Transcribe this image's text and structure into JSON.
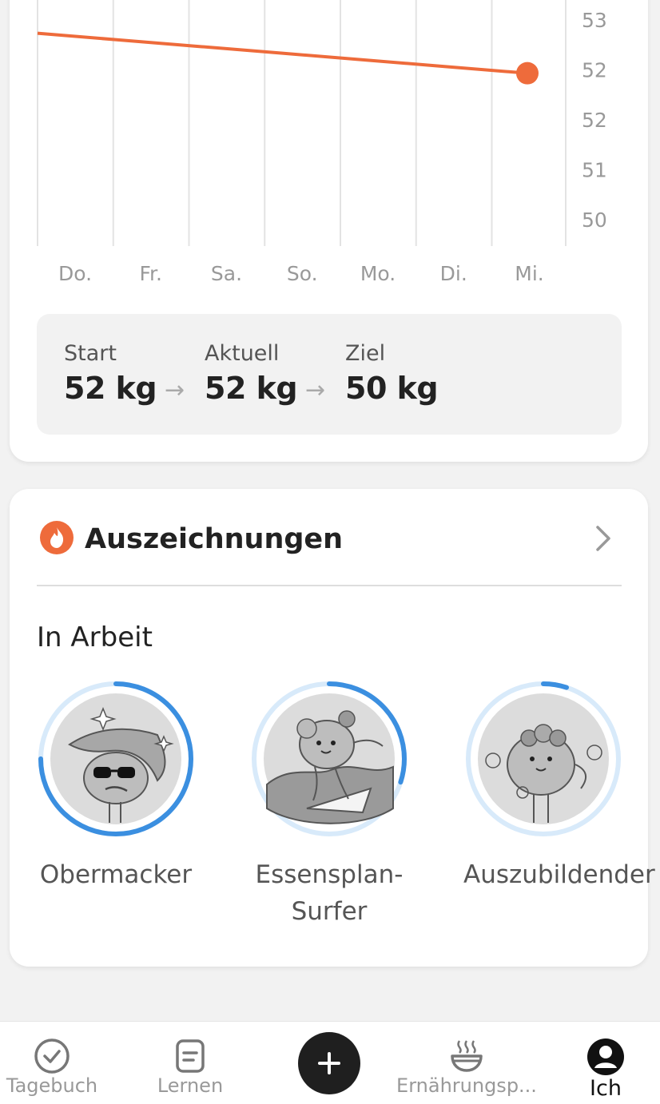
{
  "chart_data": {
    "type": "line",
    "x": [
      "Do.",
      "Fr.",
      "Sa.",
      "So.",
      "Mo.",
      "Di.",
      "Mi."
    ],
    "y_tick_labels": [
      "53",
      "52",
      "52",
      "51",
      "50"
    ],
    "series": [
      {
        "values": [
          52.8,
          52.7,
          52.6,
          52.5,
          52.4,
          52.3,
          52.2
        ]
      }
    ],
    "line_color": "#ee6b3b",
    "grid": true
  },
  "summary": {
    "start": {
      "label": "Start",
      "value": "52 kg"
    },
    "current": {
      "label": "Aktuell",
      "value": "52 kg"
    },
    "goal": {
      "label": "Ziel",
      "value": "50 kg"
    }
  },
  "awards": {
    "title": "Auszeichnungen",
    "section_label": "In Arbeit",
    "badges": [
      {
        "label": "Obermacker",
        "progress": 0.75
      },
      {
        "label": "Essensplan-Surfer",
        "progress": 0.3
      },
      {
        "label": "Auszubildender",
        "progress": 0.05
      }
    ]
  },
  "nav": {
    "items": [
      {
        "label": "Tagebuch",
        "icon": "check-circle-icon"
      },
      {
        "label": "Lernen",
        "icon": "book-icon"
      },
      {
        "label": "Ernährungsp...",
        "icon": "bowl-icon"
      },
      {
        "label": "Ich",
        "icon": "profile-icon"
      }
    ],
    "add_icon": "plus-icon"
  },
  "colors": {
    "accent": "#ee6b3b",
    "progress": "#3b8fe0",
    "progress_track": "#d8eafa"
  }
}
